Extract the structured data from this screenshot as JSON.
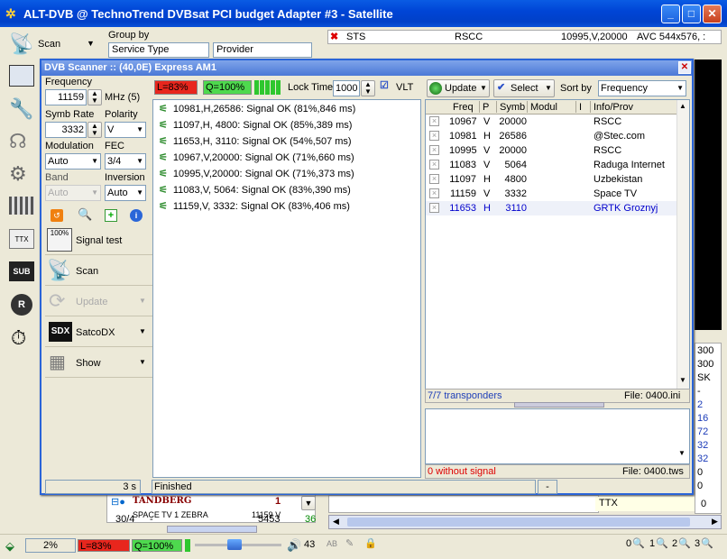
{
  "window": {
    "title": "ALT-DVB @ TechnoTrend DVBsat PCI budget Adapter #3 - Satellite"
  },
  "toolbar": {
    "scan_label": "Scan",
    "group_by_label": "Group by",
    "group_by_value": "Service Type",
    "group_by2_value": "Provider",
    "sts": "STS",
    "rscc": "RSCC",
    "freq_info": "10995,V,20000",
    "avc_info": "AVC 544x576, :"
  },
  "scanner": {
    "title": "DVB Scanner ::  (40,0E) Express AM1",
    "frequency_label": "Frequency",
    "frequency_value": "11159",
    "frequency_unit": "MHz (5)",
    "symb_rate_label": "Symb Rate",
    "symb_rate_value": "3332",
    "polarity_label": "Polarity",
    "polarity_value": "V",
    "modulation_label": "Modulation",
    "modulation_value": "Auto",
    "fec_label": "FEC",
    "fec_value": "3/4",
    "band_label": "Band",
    "band_value": "Auto",
    "inversion_label": "Inversion",
    "inversion_value": "Auto",
    "signal_test_label": "Signal test",
    "signal_test_icon_text": "100%",
    "scan_label": "Scan",
    "update_label": "Update",
    "satcodx_label": "SatcoDX",
    "show_label": "Show",
    "level_label": "L=83%",
    "quality_label": "Q=100%",
    "level": 0.83,
    "quality": 1.0,
    "lock_time_label": "Lock Time",
    "lock_time_value": "1000",
    "vlt_label": "VLT",
    "results": [
      "10981,H,26586: Signal OK (81%,846 ms)",
      "11097,H, 4800: Signal OK (85%,389 ms)",
      "11653,H, 3110: Signal OK (54%,507 ms)",
      "10967,V,20000: Signal OK (71%,660 ms)",
      "10995,V,20000: Signal OK (71%,373 ms)",
      "11083,V, 5064: Signal OK (83%,390 ms)",
      "11159,V, 3332: Signal OK (83%,406 ms)"
    ],
    "update_btn": "Update",
    "select_btn": "Select",
    "sort_by_label": "Sort by",
    "sort_by_value": "Frequency",
    "columns": [
      "Freq",
      "P",
      "Symb",
      "Modul",
      "I",
      "Info/Prov"
    ],
    "transponders": [
      {
        "freq": "10967",
        "p": "V",
        "symb": "20000",
        "info": "RSCC"
      },
      {
        "freq": "10981",
        "p": "H",
        "symb": "26586",
        "info": "@Stec.com"
      },
      {
        "freq": "10995",
        "p": "V",
        "symb": "20000",
        "info": "RSCC"
      },
      {
        "freq": "11083",
        "p": "V",
        "symb": "5064",
        "info": "Raduga Internet"
      },
      {
        "freq": "11097",
        "p": "H",
        "symb": "4800",
        "info": "Uzbekistan"
      },
      {
        "freq": "11159",
        "p": "V",
        "symb": "3332",
        "info": "Space TV"
      },
      {
        "freq": "11653",
        "p": "H",
        "symb": "3110",
        "info": "GRTK Groznyj"
      }
    ],
    "transponders_count": "7/7 transponders",
    "file_ini": "File: 0400.ini",
    "without_signal": "0 without signal",
    "file_tws": "File: 0400.tws",
    "status_time": "3 s",
    "status_text": "Finished",
    "status_dash": "-"
  },
  "background": {
    "tandberg": "TANDBERG",
    "tandberg_num": "1",
    "channel_partial": "SPACE TV 1 ZEBRA",
    "channel_partial_num": "11159 V",
    "counter": "30/4",
    "dash": "-",
    "count2": "5453",
    "count3": "36",
    "ttx": "TTX",
    "ttx_num": "0",
    "right_column": [
      "300",
      "300",
      "SK",
      "-",
      "2",
      "16",
      "72",
      "32",
      "32",
      "0",
      "0"
    ]
  },
  "statusbar": {
    "percent": "2%",
    "level": "L=83%",
    "quality": "Q=100%",
    "volume": "43",
    "ab": "AB",
    "counters": [
      "0",
      "1",
      "2",
      "3"
    ]
  },
  "colors": {
    "level": "#e8261d",
    "quality": "#4ed94e",
    "accent": "#0a5ce4",
    "link": "#0000cc"
  }
}
